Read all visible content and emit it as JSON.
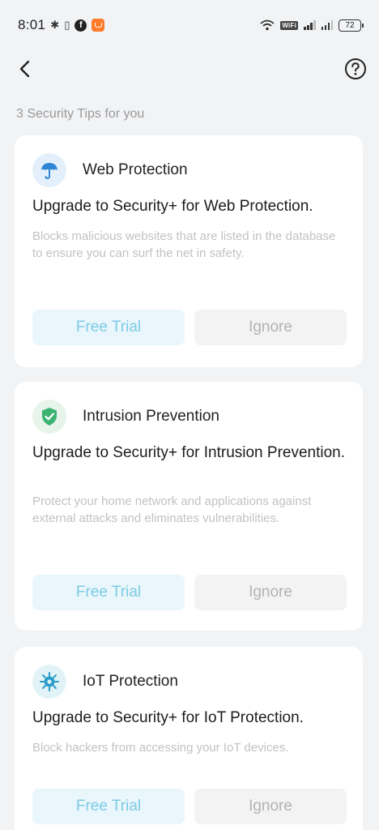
{
  "status_bar": {
    "time": "8:01",
    "wifi_badge": "WiFi",
    "battery": "72"
  },
  "header": {
    "back_icon": "chevron-left-icon",
    "help_icon": "question-circle-icon"
  },
  "section_title": "3 Security Tips for you",
  "colors": {
    "accent_text": "#7dcbe4",
    "trial_bg": "#e9f6fb",
    "ignore_bg": "#f3f3f3"
  },
  "cards": [
    {
      "icon": "umbrella-icon",
      "name": "Web Protection",
      "heading": "Upgrade to Security+ for Web Protection.",
      "description": "Blocks malicious websites that are listed in the database to ensure you can surf the net in safety.",
      "primary_label": "Free Trial",
      "secondary_label": "Ignore"
    },
    {
      "icon": "shield-check-icon",
      "name": "Intrusion Prevention",
      "heading": "Upgrade to Security+ for Intrusion Prevention.",
      "description": "Protect your home network and applications against external attacks and eliminates vulnerabilities.",
      "primary_label": "Free Trial",
      "secondary_label": "Ignore"
    },
    {
      "icon": "iot-chip-icon",
      "name": "IoT Protection",
      "heading": "Upgrade to Security+ for IoT Protection.",
      "description": "Block hackers from accessing your IoT devices.",
      "primary_label": "Free Trial",
      "secondary_label": "Ignore"
    }
  ]
}
